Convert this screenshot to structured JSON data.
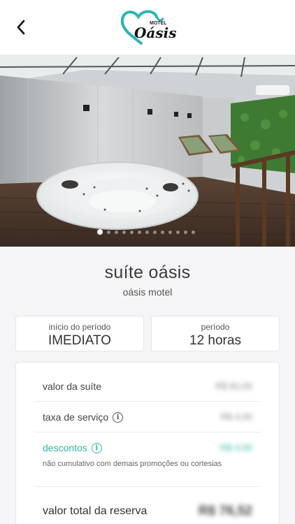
{
  "header": {
    "back_icon": "chevron-left-icon",
    "logo": {
      "small_text": "MOTEL",
      "big_text": "Oásis",
      "heart_color": "#2bb3b8"
    }
  },
  "gallery": {
    "image": "jacuzzi-suite-photo",
    "total_slides": 13,
    "active_slide": 1
  },
  "suite": {
    "name": "suíte oásis",
    "motel": "oásis motel"
  },
  "period_start": {
    "label": "início do período",
    "value": "IMEDIATO"
  },
  "period": {
    "label": "período",
    "value": "12 horas"
  },
  "summary": {
    "suite_value": {
      "label": "valor da suíte",
      "value": "R$ 82,00"
    },
    "service_fee": {
      "label": "taxa de serviço",
      "value": "R$ 4,00"
    },
    "discounts": {
      "label": "descontos",
      "value": "-R$ 4,00",
      "note": "não cumulativo com demais promoções ou cortesias"
    },
    "total": {
      "label": "valor total da reserva",
      "value": "R$ 76,52"
    }
  },
  "colors": {
    "accent": "#2db9a6",
    "background": "#f5f5f7"
  }
}
